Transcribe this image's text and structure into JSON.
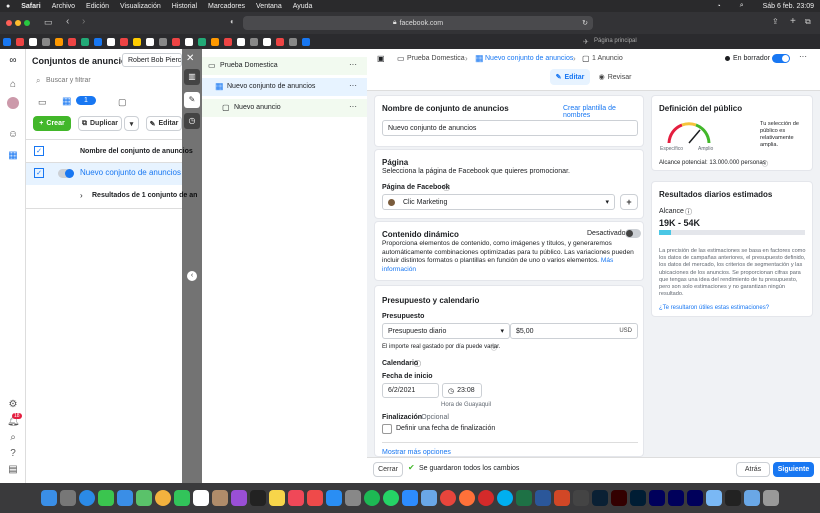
{
  "menubar": {
    "apple": "",
    "items": [
      "Safari",
      "Archivo",
      "Edición",
      "Visualización",
      "Historial",
      "Marcadores",
      "Ventana",
      "Ayuda"
    ],
    "clock": "Sáb 6 feb. 23:09"
  },
  "browser": {
    "url": "facebook.com",
    "favorite_label": "Página principal"
  },
  "campaigns": {
    "title": "Conjuntos de anuncios",
    "account": "Robert Bob Pierce (",
    "search_placeholder": "Buscar y filtrar",
    "selected_count": "1",
    "create": "Crear",
    "duplicate": "Duplicar",
    "edit": "Editar",
    "column_header": "Nombre del conjunto de anuncios",
    "row_name": "Nuevo conjunto de anuncios",
    "results": "Resultados de 1 conjunto de an"
  },
  "tree": {
    "campaign": "Prueba Domestica",
    "adset": "Nuevo conjunto de anuncios",
    "ad": "Nuevo anuncio"
  },
  "breadcrumb": {
    "campaign": "Prueba Domestica",
    "adset": "Nuevo conjunto de anuncios",
    "ad": "1 Anuncio",
    "status": "En borrador"
  },
  "tabs": {
    "edit": "Editar",
    "review": "Revisar"
  },
  "name_section": {
    "title": "Nombre de conjunto de anuncios",
    "template_link": "Crear plantilla de nombres",
    "value": "Nuevo conjunto de anuncios"
  },
  "page_section": {
    "title": "Página",
    "desc": "Selecciona la página de Facebook que quieres promocionar.",
    "field_label": "Página de Facebook",
    "page_value": "Clic Marketing"
  },
  "dynamic": {
    "title": "Contenido dinámico",
    "toggle_label": "Desactivado",
    "desc": "Proporciona elementos de contenido, como imágenes y títulos, y generaremos automáticamente combinaciones optimizadas para tu público. Las variaciones pueden incluir distintos formatos o plantillas en función de uno o varios elementos.",
    "more": "Más información"
  },
  "budget": {
    "title": "Presupuesto y calendario",
    "budget_label": "Presupuesto",
    "type": "Presupuesto diario",
    "amount": "$5,00",
    "currency": "USD",
    "note": "El importe real gastado por día puede variar.",
    "calendar_label": "Calendario",
    "start_label": "Fecha de inicio",
    "start_date": "6/2/2021",
    "start_time": "23:08",
    "timezone": "Hora de Guayaquil",
    "end_label": "Finalización",
    "end_optional": "· Opcional",
    "end_checkbox": "Definir una fecha de finalización",
    "more_options": "Mostrar más opciones"
  },
  "audience": {
    "title": "Definición del público",
    "desc": "Tu selección de público es relativamente amplia.",
    "specific": "Específico",
    "broad": "Amplio",
    "reach": "Alcance potencial: 13.000.000 personas"
  },
  "results": {
    "title": "Resultados diarios estimados",
    "reach_label": "Alcance",
    "reach_value": "19K - 54K",
    "desc": "La precisión de las estimaciones se basa en factores como los datos de campañas anteriores, el presupuesto definido, los datos del mercado, los criterios de segmentación y las ubicaciones de los anuncios. Se proporcionan cifras para que tengas una idea del rendimiento de tu presupuesto, pero son solo estimaciones y no garantizan ningún resultado.",
    "feedback": "¿Te resultaron útiles estas estimaciones?"
  },
  "footer": {
    "close": "Cerrar",
    "saved": "Se guardaron todos los cambios",
    "back": "Atrás",
    "next": "Siguiente"
  },
  "dock_notification": "18"
}
